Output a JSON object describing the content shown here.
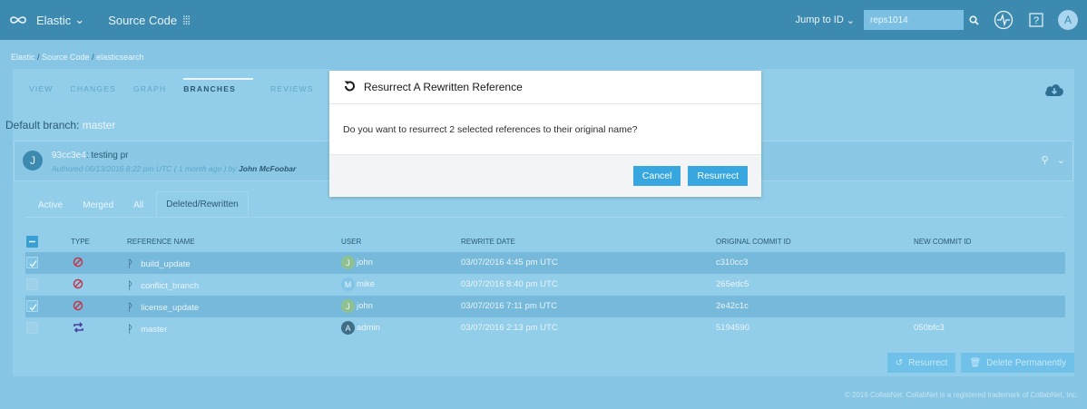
{
  "topbar": {
    "brand": "Elastic",
    "app": "Source Code",
    "jump": "Jump to ID",
    "search_value": "reps1014",
    "avatar_letter": "A"
  },
  "breadcrumb": [
    "Elastic",
    "Source Code",
    "elasticsearch"
  ],
  "tabs": [
    "VIEW",
    "CHANGES",
    "GRAPH",
    "BRANCHES",
    "REVIEWS"
  ],
  "active_tab": "BRANCHES",
  "default_branch": {
    "label": "Default branch:",
    "value": "master"
  },
  "commit": {
    "avatar": "J",
    "id": "93cc3e4",
    "message": ": testing pr",
    "meta": "Authored 06/13/2016 8:22 pm UTC ( 1 month ago ) by",
    "author": "John McFoobar"
  },
  "subtabs": [
    "Active",
    "Merged",
    "All",
    "Deleted/Rewritten"
  ],
  "table": {
    "headers": [
      "TYPE",
      "REFERENCE NAME",
      "USER",
      "REWRITE DATE",
      "ORIGINAL COMMIT ID",
      "NEW COMMIT ID"
    ],
    "rows": [
      {
        "selected": true,
        "type_icon": "deleted-icon",
        "ref": "build_update",
        "avatar": "J",
        "avatar_color": "#8fc08f",
        "user": "john",
        "date": "03/07/2016 4:45 pm UTC",
        "orig": "c310cc3",
        "new": ""
      },
      {
        "selected": false,
        "type_icon": "deleted-icon",
        "ref": "conflict_branch",
        "avatar": "M",
        "avatar_color": "#82c4e6",
        "user": "mike",
        "date": "03/07/2016 8:40 pm UTC",
        "orig": "265edc5",
        "new": ""
      },
      {
        "selected": true,
        "type_icon": "deleted-icon",
        "ref": "license_update",
        "avatar": "J",
        "avatar_color": "#8fc08f",
        "user": "john",
        "date": "03/07/2016 7:11 pm UTC",
        "orig": "2e42c1c",
        "new": ""
      },
      {
        "selected": false,
        "type_icon": "rewritten-icon",
        "ref": "master",
        "avatar": "A",
        "avatar_color": "#3f6e88",
        "user": "admin",
        "date": "03/07/2016 2:13 pm UTC",
        "orig": "5194590",
        "new": "050bfc3"
      }
    ]
  },
  "actions": {
    "resurrect": "Resurrect",
    "delete": "Delete Permanently"
  },
  "footer": "© 2016 CollabNet. CollabNet is a registered trademark of CollabNet, Inc.",
  "modal": {
    "title": "Resurrect A Rewritten Reference",
    "body": "Do you want to resurrect 2 selected references to their original name?",
    "cancel": "Cancel",
    "confirm": "Resurrect"
  }
}
